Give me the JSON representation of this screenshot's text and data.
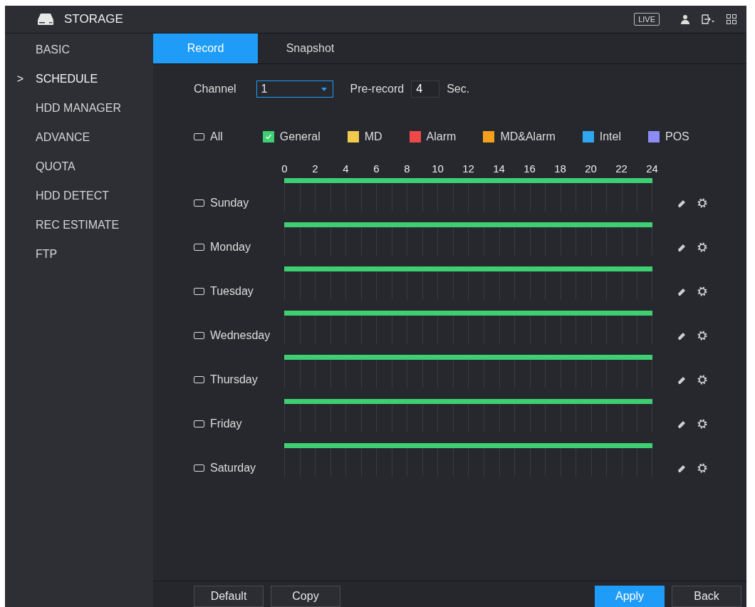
{
  "header": {
    "title": "STORAGE",
    "live_button": "LIVE"
  },
  "sidebar": {
    "items": [
      {
        "label": "BASIC",
        "selected": false
      },
      {
        "label": "SCHEDULE",
        "selected": true,
        "marker": ">"
      },
      {
        "label": "HDD MANAGER",
        "selected": false
      },
      {
        "label": "ADVANCE",
        "selected": false
      },
      {
        "label": "QUOTA",
        "selected": false
      },
      {
        "label": "HDD DETECT",
        "selected": false
      },
      {
        "label": "REC ESTIMATE",
        "selected": false
      },
      {
        "label": "FTP",
        "selected": false
      }
    ]
  },
  "tabs": [
    {
      "label": "Record",
      "selected": true
    },
    {
      "label": "Snapshot",
      "selected": false
    }
  ],
  "channel": {
    "label": "Channel",
    "value": "1"
  },
  "pre_record": {
    "label": "Pre-record",
    "value": "4",
    "unit": "Sec."
  },
  "legend": [
    {
      "label": "All",
      "kind": "all",
      "checked": false
    },
    {
      "label": "General",
      "kind": "general",
      "checked": true,
      "color": "#3ecf72"
    },
    {
      "label": "MD",
      "kind": "type",
      "checked": false,
      "color": "#f2c94c"
    },
    {
      "label": "Alarm",
      "kind": "type",
      "checked": false,
      "color": "#f04848"
    },
    {
      "label": "MD&Alarm",
      "kind": "type",
      "checked": false,
      "color": "#f5a01a"
    },
    {
      "label": "Intel",
      "kind": "type",
      "checked": false,
      "color": "#2ea7f0"
    },
    {
      "label": "POS",
      "kind": "type",
      "checked": false,
      "color": "#8c8cf5"
    }
  ],
  "hour_ticks": [
    "0",
    "2",
    "4",
    "6",
    "8",
    "10",
    "12",
    "14",
    "16",
    "18",
    "20",
    "22",
    "24"
  ],
  "days": [
    {
      "name": "Sunday",
      "checked": false,
      "color": "#3ecf72"
    },
    {
      "name": "Monday",
      "checked": false,
      "color": "#3ecf72"
    },
    {
      "name": "Tuesday",
      "checked": false,
      "color": "#3ecf72"
    },
    {
      "name": "Wednesday",
      "checked": false,
      "color": "#3ecf72"
    },
    {
      "name": "Thursday",
      "checked": false,
      "color": "#3ecf72"
    },
    {
      "name": "Friday",
      "checked": false,
      "color": "#3ecf72"
    },
    {
      "name": "Saturday",
      "checked": false,
      "color": "#3ecf72"
    }
  ],
  "buttons": [
    {
      "label": "Default",
      "kind": "plain"
    },
    {
      "label": "Copy",
      "kind": "plain"
    },
    {
      "label": "Apply",
      "kind": "primary"
    },
    {
      "label": "Back",
      "kind": "plain"
    }
  ]
}
